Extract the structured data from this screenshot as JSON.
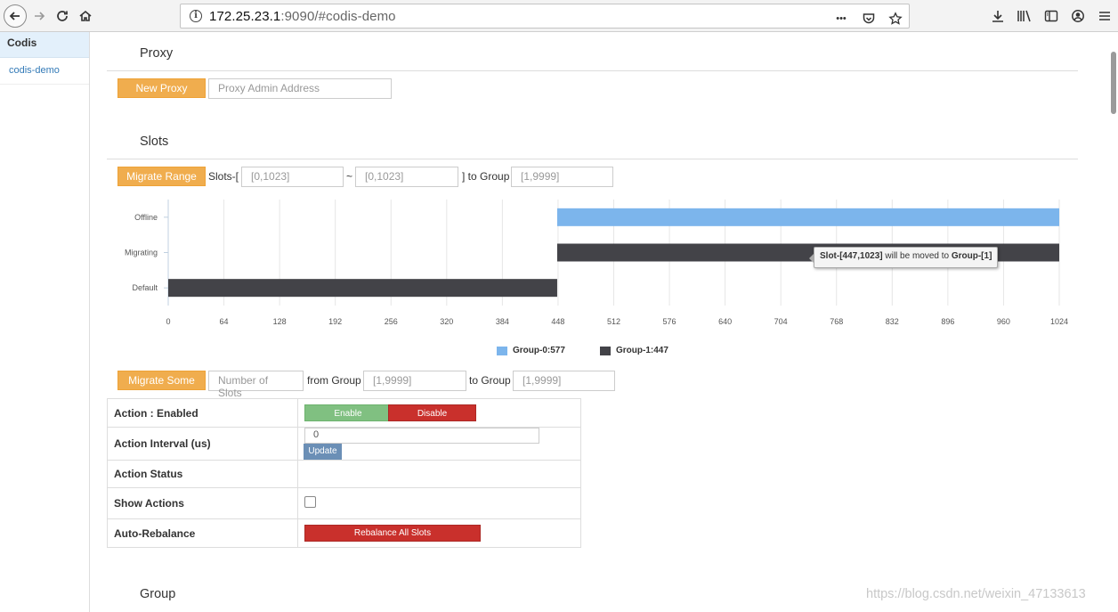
{
  "browser": {
    "url_host": "172.25.23.1",
    "url_rest": ":9090/#codis-demo",
    "more_glyph": "•••"
  },
  "sidebar": {
    "brand": "Codis",
    "items": [
      {
        "label": "codis-demo"
      }
    ]
  },
  "proxy": {
    "title": "Proxy",
    "new_proxy_label": "New Proxy",
    "address_placeholder": "Proxy Admin Address"
  },
  "slots": {
    "title": "Slots",
    "migrate_range_label": "Migrate Range",
    "slots_prefix": "Slots-[",
    "from_placeholder": "[0,1023]",
    "tilde": "~",
    "to_placeholder": "[0,1023]",
    "to_group_label": "] to Group",
    "group_placeholder": "[1,9999]"
  },
  "chart_data": {
    "type": "bar",
    "orientation": "horizontal",
    "categories": [
      "Offline",
      "Migrating",
      "Default"
    ],
    "x_ticks": [
      0,
      64,
      128,
      192,
      256,
      320,
      384,
      448,
      512,
      576,
      640,
      704,
      768,
      832,
      896,
      960,
      1024
    ],
    "xlim": [
      0,
      1024
    ],
    "grid": true,
    "bars": [
      {
        "category": "Offline",
        "start": 447,
        "end": 1023,
        "series": "Group-0:577"
      },
      {
        "category": "Migrating",
        "start": 447,
        "end": 1023,
        "series": "Group-1:447"
      },
      {
        "category": "Default",
        "start": 0,
        "end": 446,
        "series": "Group-1:447"
      }
    ],
    "series": [
      {
        "name": "Group-0:577",
        "color": "#7cb5ec"
      },
      {
        "name": "Group-1:447",
        "color": "#434348"
      }
    ],
    "legend_position": "bottom-center",
    "tooltip": {
      "slot": "Slot-[447,1023]",
      "text": "will be moved to",
      "group": "Group-[1]"
    }
  },
  "migrate_some": {
    "button_label": "Migrate Some",
    "count_placeholder": "Number of Slots",
    "from_group_label": "from Group",
    "from_placeholder": "[1,9999]",
    "to_group_label": "to Group",
    "to_placeholder": "[1,9999]"
  },
  "settings": {
    "rows": [
      {
        "label": "Action : Enabled"
      },
      {
        "label": "Action Interval (us)"
      },
      {
        "label": "Action Status"
      },
      {
        "label": "Show Actions"
      },
      {
        "label": "Auto-Rebalance"
      }
    ],
    "enable_label": "Enable",
    "disable_label": "Disable",
    "interval_value": "0",
    "update_label": "Update",
    "rebalance_label": "Rebalance All Slots"
  },
  "group": {
    "title": "Group"
  },
  "watermark": "https://blog.csdn.net/weixin_47133613",
  "colors": {
    "warning": "#f0ad4e",
    "success": "#80c081",
    "danger": "#c9302c",
    "primary_link": "#337ab7"
  }
}
